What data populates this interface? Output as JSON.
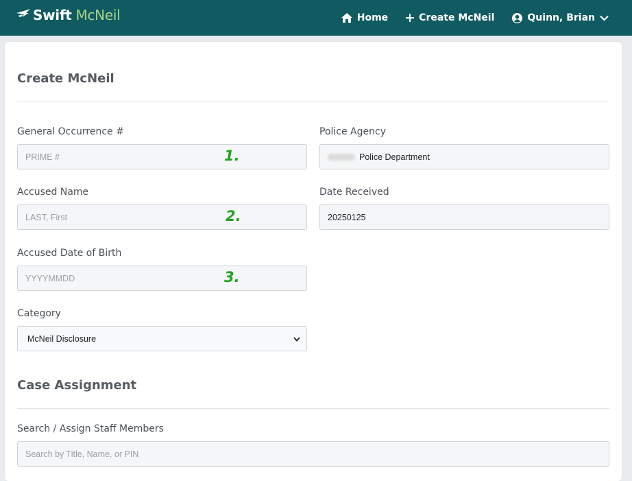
{
  "brand": {
    "swift": "Swift",
    "mcneil": "McNeil"
  },
  "nav": {
    "home_label": "Home",
    "create_label": "Create McNeil",
    "user_label": "Quinn, Brian"
  },
  "page": {
    "title": "Create McNeil"
  },
  "form": {
    "occurrence": {
      "label": "General Occurrence #",
      "placeholder": "PRIME #",
      "annotation": "1."
    },
    "agency": {
      "label": "Police Agency",
      "value": "Police Department"
    },
    "accused_name": {
      "label": "Accused Name",
      "placeholder": "LAST, First",
      "annotation": "2."
    },
    "date_received": {
      "label": "Date Received",
      "value": "20250125"
    },
    "dob": {
      "label": "Accused Date of Birth",
      "placeholder": "YYYYMMDD",
      "annotation": "3."
    },
    "category": {
      "label": "Category",
      "selected": "McNeil Disclosure"
    }
  },
  "case_assignment": {
    "title": "Case Assignment",
    "search_label": "Search / Assign Staff Members",
    "search_placeholder": "Search by Title, Name, or PIN"
  },
  "colors": {
    "navbar": "#0f5b61",
    "brand_accent": "#a8d58a",
    "annotation": "#22a31f"
  },
  "icons": [
    "bird-logo-icon",
    "home-icon",
    "plus-icon",
    "user-circle-icon",
    "chevron-down-icon",
    "select-chevron-icon"
  ]
}
